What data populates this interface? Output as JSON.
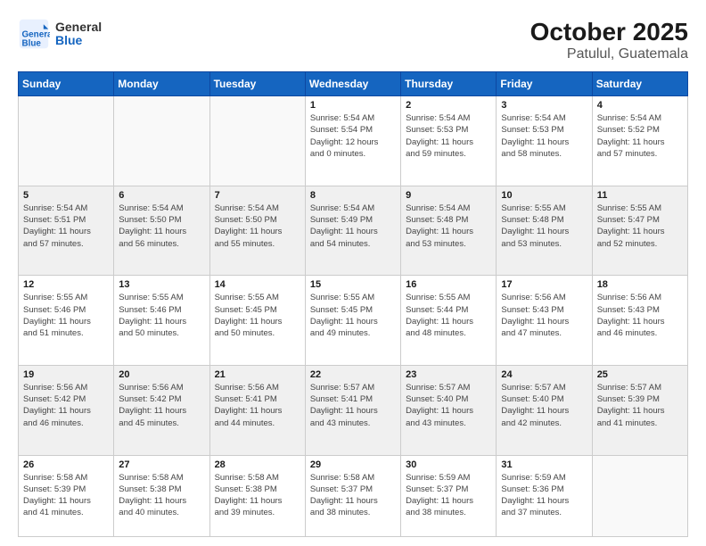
{
  "header": {
    "logo_line1": "General",
    "logo_line2": "Blue",
    "title": "October 2025",
    "subtitle": "Patulul, Guatemala"
  },
  "calendar": {
    "days_of_week": [
      "Sunday",
      "Monday",
      "Tuesday",
      "Wednesday",
      "Thursday",
      "Friday",
      "Saturday"
    ],
    "weeks": [
      [
        {
          "day": "",
          "info": ""
        },
        {
          "day": "",
          "info": ""
        },
        {
          "day": "",
          "info": ""
        },
        {
          "day": "1",
          "info": "Sunrise: 5:54 AM\nSunset: 5:54 PM\nDaylight: 12 hours\nand 0 minutes."
        },
        {
          "day": "2",
          "info": "Sunrise: 5:54 AM\nSunset: 5:53 PM\nDaylight: 11 hours\nand 59 minutes."
        },
        {
          "day": "3",
          "info": "Sunrise: 5:54 AM\nSunset: 5:53 PM\nDaylight: 11 hours\nand 58 minutes."
        },
        {
          "day": "4",
          "info": "Sunrise: 5:54 AM\nSunset: 5:52 PM\nDaylight: 11 hours\nand 57 minutes."
        }
      ],
      [
        {
          "day": "5",
          "info": "Sunrise: 5:54 AM\nSunset: 5:51 PM\nDaylight: 11 hours\nand 57 minutes."
        },
        {
          "day": "6",
          "info": "Sunrise: 5:54 AM\nSunset: 5:50 PM\nDaylight: 11 hours\nand 56 minutes."
        },
        {
          "day": "7",
          "info": "Sunrise: 5:54 AM\nSunset: 5:50 PM\nDaylight: 11 hours\nand 55 minutes."
        },
        {
          "day": "8",
          "info": "Sunrise: 5:54 AM\nSunset: 5:49 PM\nDaylight: 11 hours\nand 54 minutes."
        },
        {
          "day": "9",
          "info": "Sunrise: 5:54 AM\nSunset: 5:48 PM\nDaylight: 11 hours\nand 53 minutes."
        },
        {
          "day": "10",
          "info": "Sunrise: 5:55 AM\nSunset: 5:48 PM\nDaylight: 11 hours\nand 53 minutes."
        },
        {
          "day": "11",
          "info": "Sunrise: 5:55 AM\nSunset: 5:47 PM\nDaylight: 11 hours\nand 52 minutes."
        }
      ],
      [
        {
          "day": "12",
          "info": "Sunrise: 5:55 AM\nSunset: 5:46 PM\nDaylight: 11 hours\nand 51 minutes."
        },
        {
          "day": "13",
          "info": "Sunrise: 5:55 AM\nSunset: 5:46 PM\nDaylight: 11 hours\nand 50 minutes."
        },
        {
          "day": "14",
          "info": "Sunrise: 5:55 AM\nSunset: 5:45 PM\nDaylight: 11 hours\nand 50 minutes."
        },
        {
          "day": "15",
          "info": "Sunrise: 5:55 AM\nSunset: 5:45 PM\nDaylight: 11 hours\nand 49 minutes."
        },
        {
          "day": "16",
          "info": "Sunrise: 5:55 AM\nSunset: 5:44 PM\nDaylight: 11 hours\nand 48 minutes."
        },
        {
          "day": "17",
          "info": "Sunrise: 5:56 AM\nSunset: 5:43 PM\nDaylight: 11 hours\nand 47 minutes."
        },
        {
          "day": "18",
          "info": "Sunrise: 5:56 AM\nSunset: 5:43 PM\nDaylight: 11 hours\nand 46 minutes."
        }
      ],
      [
        {
          "day": "19",
          "info": "Sunrise: 5:56 AM\nSunset: 5:42 PM\nDaylight: 11 hours\nand 46 minutes."
        },
        {
          "day": "20",
          "info": "Sunrise: 5:56 AM\nSunset: 5:42 PM\nDaylight: 11 hours\nand 45 minutes."
        },
        {
          "day": "21",
          "info": "Sunrise: 5:56 AM\nSunset: 5:41 PM\nDaylight: 11 hours\nand 44 minutes."
        },
        {
          "day": "22",
          "info": "Sunrise: 5:57 AM\nSunset: 5:41 PM\nDaylight: 11 hours\nand 43 minutes."
        },
        {
          "day": "23",
          "info": "Sunrise: 5:57 AM\nSunset: 5:40 PM\nDaylight: 11 hours\nand 43 minutes."
        },
        {
          "day": "24",
          "info": "Sunrise: 5:57 AM\nSunset: 5:40 PM\nDaylight: 11 hours\nand 42 minutes."
        },
        {
          "day": "25",
          "info": "Sunrise: 5:57 AM\nSunset: 5:39 PM\nDaylight: 11 hours\nand 41 minutes."
        }
      ],
      [
        {
          "day": "26",
          "info": "Sunrise: 5:58 AM\nSunset: 5:39 PM\nDaylight: 11 hours\nand 41 minutes."
        },
        {
          "day": "27",
          "info": "Sunrise: 5:58 AM\nSunset: 5:38 PM\nDaylight: 11 hours\nand 40 minutes."
        },
        {
          "day": "28",
          "info": "Sunrise: 5:58 AM\nSunset: 5:38 PM\nDaylight: 11 hours\nand 39 minutes."
        },
        {
          "day": "29",
          "info": "Sunrise: 5:58 AM\nSunset: 5:37 PM\nDaylight: 11 hours\nand 38 minutes."
        },
        {
          "day": "30",
          "info": "Sunrise: 5:59 AM\nSunset: 5:37 PM\nDaylight: 11 hours\nand 38 minutes."
        },
        {
          "day": "31",
          "info": "Sunrise: 5:59 AM\nSunset: 5:36 PM\nDaylight: 11 hours\nand 37 minutes."
        },
        {
          "day": "",
          "info": ""
        }
      ]
    ]
  }
}
